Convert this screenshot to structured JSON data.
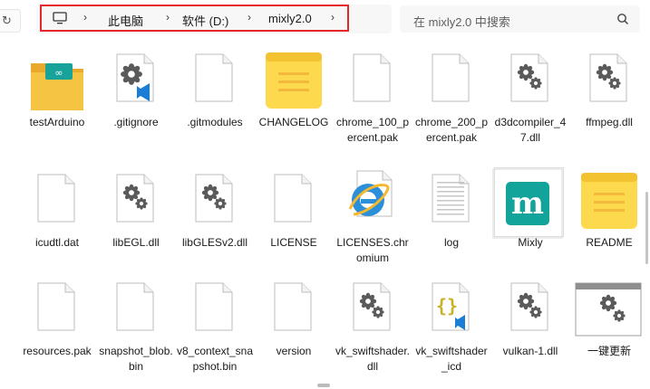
{
  "toolbar": {
    "refresh_glyph": "↻",
    "breadcrumb": [
      "此电脑",
      "软件 (D:)",
      "mixly2.0"
    ],
    "search_placeholder": "在 mixly2.0 中搜索"
  },
  "files": [
    {
      "name": "testArduino",
      "icon": "folder-icon"
    },
    {
      "name": ".gitignore",
      "icon": "gear-vscode-file-icon"
    },
    {
      "name": ".gitmodules",
      "icon": "blank-file-icon"
    },
    {
      "name": "CHANGELOG",
      "icon": "notepad-icon"
    },
    {
      "name": "chrome_100_percent.pak",
      "icon": "blank-file-icon"
    },
    {
      "name": "chrome_200_percent.pak",
      "icon": "blank-file-icon"
    },
    {
      "name": "d3dcompiler_47.dll",
      "icon": "gear-file-icon"
    },
    {
      "name": "ffmpeg.dll",
      "icon": "gear-file-icon"
    },
    {
      "name": "icudtl.dat",
      "icon": "blank-file-icon"
    },
    {
      "name": "libEGL.dll",
      "icon": "gear-file-icon"
    },
    {
      "name": "libGLESv2.dll",
      "icon": "gear-file-icon"
    },
    {
      "name": "LICENSE",
      "icon": "blank-file-icon"
    },
    {
      "name": "LICENSES.chromium",
      "icon": "internet-explorer-icon"
    },
    {
      "name": "log",
      "icon": "text-file-icon"
    },
    {
      "name": "Mixly",
      "icon": "mixly-app-icon"
    },
    {
      "name": "README",
      "icon": "notepad-icon"
    },
    {
      "name": "resources.pak",
      "icon": "blank-file-icon"
    },
    {
      "name": "snapshot_blob.bin",
      "icon": "blank-file-icon"
    },
    {
      "name": "v8_context_snapshot.bin",
      "icon": "blank-file-icon"
    },
    {
      "name": "version",
      "icon": "blank-file-icon"
    },
    {
      "name": "vk_swiftshader.dll",
      "icon": "gear-file-icon"
    },
    {
      "name": "vk_swiftshader_icd",
      "icon": "json-vscode-file-icon"
    },
    {
      "name": "vulkan-1.dll",
      "icon": "gear-file-icon"
    },
    {
      "name": "一键更新",
      "icon": "batch-file-icon"
    }
  ],
  "colors": {
    "highlight_border": "#e5262b",
    "folder": "#f6c443",
    "notepad": "#fdd94e",
    "mixly": "#12a39a",
    "vscode_blue": "#1a7ed6"
  }
}
